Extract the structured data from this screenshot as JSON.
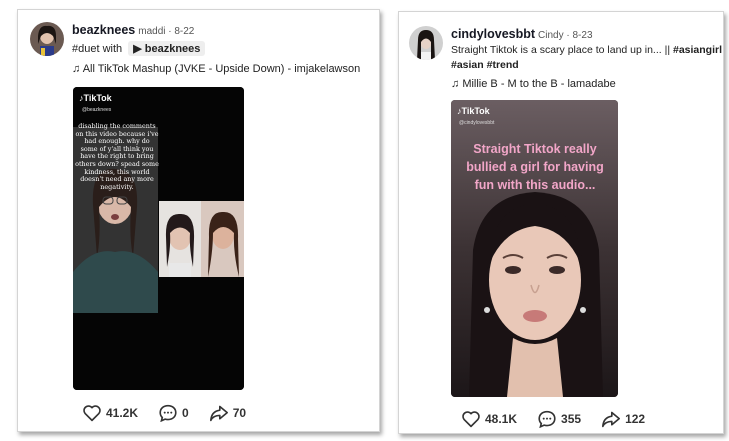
{
  "post1": {
    "username": "beazknees",
    "display_meta": "maddi · 8-22",
    "caption_tag": "#duet with",
    "duet_user": "beazknees",
    "music": "All TikTok Mashup (JVKE - Upside Down) - imjakelawson",
    "watermark": "TikTok",
    "watermark_handle": "@beazknees",
    "overlay_text": "disabling the comments on this video because i've had enough. why do some of y'all think you have the right to bring others down? spead some kindness, this world doesn't need any more negativity.",
    "likes": "41.2K",
    "comments": "0",
    "shares": "70"
  },
  "post2": {
    "username": "cindylovesbbt",
    "display_meta": "Cindy · 8-23",
    "caption": "Straight Tiktok is a scary place to land up in... ||",
    "caption_tag1": "#asiangirl",
    "caption_tag2": "#asian #trend",
    "music": "Millie B - M to the B - lamadabe",
    "watermark": "TikTok",
    "watermark_handle": "@cindylovesbbt",
    "overlay_text": "Straight Tiktok really bullied a girl for having fun with this audio...",
    "likes": "48.1K",
    "comments": "355",
    "shares": "122"
  },
  "icons": {
    "heart": "heart-icon",
    "comment": "comment-icon",
    "share": "share-icon",
    "music": "music-note-icon",
    "play": "play-icon"
  }
}
